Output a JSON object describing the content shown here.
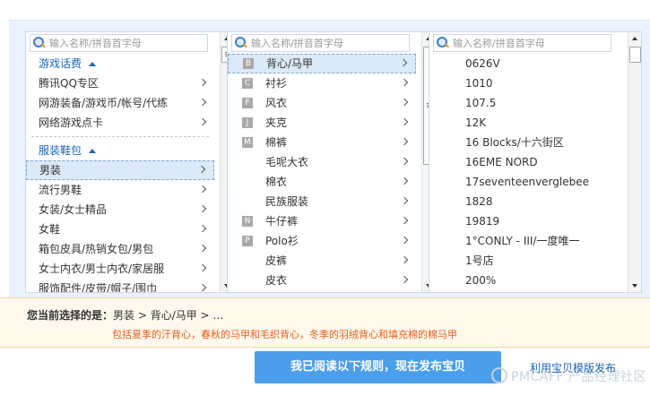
{
  "search_placeholder": "输入名称/拼音首字母",
  "col1": {
    "group1": "游戏话费",
    "group1_items": [
      "腾讯QQ专区",
      "网游装备/游戏币/帐号/代练",
      "网络游戏点卡"
    ],
    "group2": "服装鞋包",
    "group2_items": [
      "男装",
      "流行男鞋",
      "女装/女士精品",
      "女鞋",
      "箱包皮具/热销女包/男包",
      "女士内衣/男士内衣/家居服",
      "服饰配件/皮带/帽子/围巾"
    ]
  },
  "col2": {
    "items": [
      {
        "letter": "B",
        "label": "背心/马甲"
      },
      {
        "letter": "C",
        "label": "衬衫"
      },
      {
        "letter": "F",
        "label": "风衣"
      },
      {
        "letter": "J",
        "label": "夹克"
      },
      {
        "letter": "M",
        "label": "棉裤"
      },
      {
        "letter": "",
        "label": "毛呢大衣"
      },
      {
        "letter": "",
        "label": "棉衣"
      },
      {
        "letter": "",
        "label": "民族服装"
      },
      {
        "letter": "N",
        "label": "牛仔裤"
      },
      {
        "letter": "P",
        "label": "Polo衫"
      },
      {
        "letter": "",
        "label": "皮裤"
      },
      {
        "letter": "",
        "label": "皮衣"
      }
    ]
  },
  "col3": {
    "items": [
      "0626V",
      "1010",
      "107.5",
      "12K",
      "16 Blocks/十六街区",
      "16EME NORD",
      "17seventeenverglebee",
      "1828",
      "19819",
      "1°CONLY - III/一度唯一",
      "1号店",
      "200%"
    ]
  },
  "status": {
    "current_label": "您当前选择的是：",
    "current_path": "男装 > 背心/马甲 > …",
    "description": "包括夏季的汗背心，春秋的马甲和毛织背心，冬季的羽绒背心和填充棉的棉马甲"
  },
  "publish_button": "我已阅读以下规则，现在发布宝贝",
  "template_link": "利用宝贝模版发布",
  "watermark": "PMCAFF 产品经理社区",
  "colors": {
    "link": "#1c64b9",
    "button": "#4a9eea",
    "desc": "#e5601e"
  }
}
